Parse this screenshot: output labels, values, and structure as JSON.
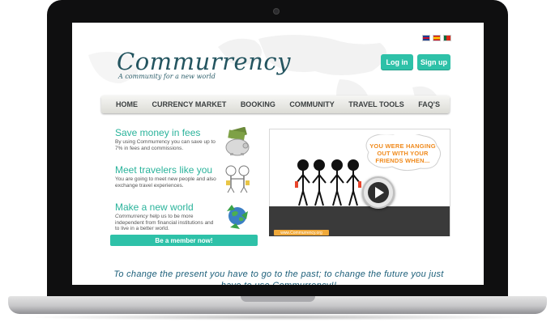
{
  "header": {
    "logo_main": "Commurrency",
    "logo_sub": "A community for a new world",
    "login_label": "Log in",
    "signup_label": "Sign up"
  },
  "nav": {
    "items": [
      "HOME",
      "CURRENCY MARKET",
      "BOOKING",
      "COMMUNITY",
      "TRAVEL TOOLS",
      "FAQ'S"
    ]
  },
  "panels": [
    {
      "title": "Save money in fees",
      "text": "By using Commurrency you can save up to 7% in fees and commissions.",
      "icon": "piggy-bank-icon"
    },
    {
      "title": "Meet travelers like you",
      "text": "You are going to meet new people and also exchange travel experiences.",
      "icon": "people-icon"
    },
    {
      "title": "Make a new world",
      "text_italic": "Commurrency",
      "text": " help us to be more independent from financial institutions and to live in a better world.",
      "icon": "recycle-globe-icon"
    }
  ],
  "member_button": "Be a member now!",
  "video": {
    "speech": "YOU WERE HANGING OUT WITH YOUR FRIENDS WHEN...",
    "url_label": "www.Commurrency.org"
  },
  "tagline": "To change the present  you have to go to the past; to change the future  you  just have to use Commurrency!!",
  "colors": {
    "accent": "#2ec1a8",
    "logo": "#245560",
    "tagline": "#1b5e79",
    "speech": "#f08a1c"
  }
}
